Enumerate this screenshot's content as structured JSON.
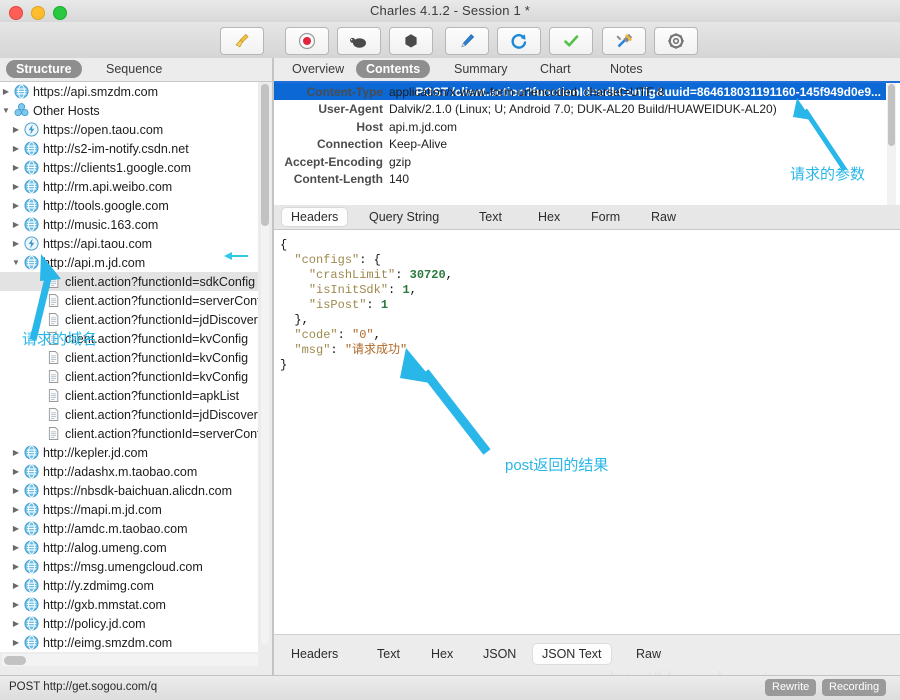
{
  "window": {
    "title": "Charles 4.1.2 - Session 1 *",
    "traffic_lights": [
      "close",
      "minimize",
      "zoom"
    ]
  },
  "toolbar": {
    "buttons": [
      {
        "name": "clear-session-button",
        "icon": "broom-icon"
      },
      {
        "name": "start-recording-button",
        "icon": "record-circle-icon"
      },
      {
        "name": "throttle-button",
        "icon": "turtle-icon"
      },
      {
        "name": "breakpoints-button",
        "icon": "stop-hexagon-icon"
      },
      {
        "name": "compose-button",
        "icon": "pen-icon"
      },
      {
        "name": "repeat-button",
        "icon": "refresh-icon"
      },
      {
        "name": "validate-button",
        "icon": "checkmark-icon"
      },
      {
        "name": "tools-button",
        "icon": "tools-icon"
      },
      {
        "name": "settings-button",
        "icon": "gear-icon"
      }
    ]
  },
  "left_pane": {
    "tabs": [
      {
        "label": "Structure",
        "active": true
      },
      {
        "label": "Sequence",
        "active": false
      }
    ],
    "tree": [
      {
        "label": "https://api.smzdm.com",
        "icon": "globe-icon",
        "depth": 0,
        "disclosure": "collapsed",
        "selected": false
      },
      {
        "label": "Other Hosts",
        "icon": "hosts-icon",
        "depth": 0,
        "disclosure": "expanded",
        "selected": false
      },
      {
        "label": "https://open.taou.com",
        "icon": "bolt-icon",
        "depth": 1,
        "disclosure": "collapsed",
        "selected": false
      },
      {
        "label": "http://s2-im-notify.csdn.net",
        "icon": "globe-icon",
        "depth": 1,
        "disclosure": "collapsed",
        "selected": false
      },
      {
        "label": "https://clients1.google.com",
        "icon": "globe-icon",
        "depth": 1,
        "disclosure": "collapsed",
        "selected": false
      },
      {
        "label": "http://rm.api.weibo.com",
        "icon": "globe-icon",
        "depth": 1,
        "disclosure": "collapsed",
        "selected": false
      },
      {
        "label": "http://tools.google.com",
        "icon": "globe-icon",
        "depth": 1,
        "disclosure": "collapsed",
        "selected": false
      },
      {
        "label": "http://music.163.com",
        "icon": "globe-icon",
        "depth": 1,
        "disclosure": "collapsed",
        "selected": false
      },
      {
        "label": "https://api.taou.com",
        "icon": "bolt-icon",
        "depth": 1,
        "disclosure": "collapsed",
        "selected": false
      },
      {
        "label": "http://api.m.jd.com",
        "icon": "globe-icon",
        "depth": 1,
        "disclosure": "expanded",
        "selected": false
      },
      {
        "label": "client.action?functionId=sdkConfig",
        "icon": "file-icon",
        "depth": 2,
        "disclosure": "none",
        "selected": true
      },
      {
        "label": "client.action?functionId=serverConfig",
        "icon": "file-icon",
        "depth": 2,
        "disclosure": "none",
        "selected": false
      },
      {
        "label": "client.action?functionId=jdDiscovery",
        "icon": "file-icon",
        "depth": 2,
        "disclosure": "none",
        "selected": false
      },
      {
        "label": "client.action?functionId=kvConfig",
        "icon": "file-icon",
        "depth": 2,
        "disclosure": "none",
        "selected": false
      },
      {
        "label": "client.action?functionId=kvConfig",
        "icon": "file-icon",
        "depth": 2,
        "disclosure": "none",
        "selected": false
      },
      {
        "label": "client.action?functionId=kvConfig",
        "icon": "file-icon",
        "depth": 2,
        "disclosure": "none",
        "selected": false
      },
      {
        "label": "client.action?functionId=apkList",
        "icon": "file-icon",
        "depth": 2,
        "disclosure": "none",
        "selected": false
      },
      {
        "label": "client.action?functionId=jdDiscovery",
        "icon": "file-icon",
        "depth": 2,
        "disclosure": "none",
        "selected": false
      },
      {
        "label": "client.action?functionId=serverConfig",
        "icon": "file-icon",
        "depth": 2,
        "disclosure": "none",
        "selected": false
      },
      {
        "label": "http://kepler.jd.com",
        "icon": "globe-icon",
        "depth": 1,
        "disclosure": "collapsed",
        "selected": false
      },
      {
        "label": "http://adashx.m.taobao.com",
        "icon": "globe-icon",
        "depth": 1,
        "disclosure": "collapsed",
        "selected": false
      },
      {
        "label": "https://nbsdk-baichuan.alicdn.com",
        "icon": "globe-icon",
        "depth": 1,
        "disclosure": "collapsed",
        "selected": false
      },
      {
        "label": "https://mapi.m.jd.com",
        "icon": "globe-icon",
        "depth": 1,
        "disclosure": "collapsed",
        "selected": false
      },
      {
        "label": "http://amdc.m.taobao.com",
        "icon": "globe-icon",
        "depth": 1,
        "disclosure": "collapsed",
        "selected": false
      },
      {
        "label": "http://alog.umeng.com",
        "icon": "globe-icon",
        "depth": 1,
        "disclosure": "collapsed",
        "selected": false
      },
      {
        "label": "https://msg.umengcloud.com",
        "icon": "globe-icon",
        "depth": 1,
        "disclosure": "collapsed",
        "selected": false
      },
      {
        "label": "http://y.zdmimg.com",
        "icon": "globe-icon",
        "depth": 1,
        "disclosure": "collapsed",
        "selected": false
      },
      {
        "label": "http://gxb.mmstat.com",
        "icon": "globe-icon",
        "depth": 1,
        "disclosure": "collapsed",
        "selected": false
      },
      {
        "label": "http://policy.jd.com",
        "icon": "globe-icon",
        "depth": 1,
        "disclosure": "collapsed",
        "selected": false
      },
      {
        "label": "http://eimg.smzdm.com",
        "icon": "globe-icon",
        "depth": 1,
        "disclosure": "collapsed",
        "selected": false
      }
    ]
  },
  "right_pane": {
    "tabs": [
      {
        "label": "Overview",
        "active": false
      },
      {
        "label": "Contents",
        "active": true
      },
      {
        "label": "Summary",
        "active": false
      },
      {
        "label": "Chart",
        "active": false
      },
      {
        "label": "Notes",
        "active": false
      }
    ],
    "request_line": "POST /client.action?functionId=sdkConfig&uuid=864618031191160-145f949d0e9...",
    "headers": [
      {
        "key": "Content-Type",
        "value": "application/x-www-form-urlencoded; charset=UTF-8"
      },
      {
        "key": "User-Agent",
        "value": "Dalvik/2.1.0 (Linux; U; Android 7.0; DUK-AL20 Build/HUAWEIDUK-AL20)"
      },
      {
        "key": "Host",
        "value": "api.m.jd.com"
      },
      {
        "key": "Connection",
        "value": "Keep-Alive"
      },
      {
        "key": "Accept-Encoding",
        "value": "gzip"
      },
      {
        "key": "Content-Length",
        "value": "140"
      }
    ],
    "request_tabs": [
      {
        "label": "Headers",
        "active": true
      },
      {
        "label": "Query String",
        "active": false
      },
      {
        "label": "Text",
        "active": false
      },
      {
        "label": "Hex",
        "active": false
      },
      {
        "label": "Form",
        "active": false
      },
      {
        "label": "Raw",
        "active": false
      }
    ],
    "response_tabs": [
      {
        "label": "Headers",
        "active": false
      },
      {
        "label": "Text",
        "active": false
      },
      {
        "label": "Hex",
        "active": false
      },
      {
        "label": "JSON",
        "active": false
      },
      {
        "label": "JSON Text",
        "active": true
      },
      {
        "label": "Raw",
        "active": false
      }
    ],
    "json_body": {
      "lines": [
        [
          {
            "t": "punct",
            "v": "{"
          }
        ],
        [
          {
            "t": "punct",
            "v": "  "
          },
          {
            "t": "key",
            "v": "\"configs\""
          },
          {
            "t": "punct",
            "v": ": {"
          }
        ],
        [
          {
            "t": "punct",
            "v": "    "
          },
          {
            "t": "key",
            "v": "\"crashLimit\""
          },
          {
            "t": "punct",
            "v": ": "
          },
          {
            "t": "num",
            "v": "30720"
          },
          {
            "t": "punct",
            "v": ","
          }
        ],
        [
          {
            "t": "punct",
            "v": "    "
          },
          {
            "t": "key",
            "v": "\"isInitSdk\""
          },
          {
            "t": "punct",
            "v": ": "
          },
          {
            "t": "num",
            "v": "1"
          },
          {
            "t": "punct",
            "v": ","
          }
        ],
        [
          {
            "t": "punct",
            "v": "    "
          },
          {
            "t": "key",
            "v": "\"isPost\""
          },
          {
            "t": "punct",
            "v": ": "
          },
          {
            "t": "num",
            "v": "1"
          }
        ],
        [
          {
            "t": "punct",
            "v": "  },"
          }
        ],
        [
          {
            "t": "punct",
            "v": "  "
          },
          {
            "t": "key",
            "v": "\"code\""
          },
          {
            "t": "punct",
            "v": ": "
          },
          {
            "t": "str",
            "v": "\"0\""
          },
          {
            "t": "punct",
            "v": ","
          }
        ],
        [
          {
            "t": "punct",
            "v": "  "
          },
          {
            "t": "key",
            "v": "\"msg\""
          },
          {
            "t": "punct",
            "v": ": "
          },
          {
            "t": "str",
            "v": "\"请求成功\""
          }
        ],
        [
          {
            "t": "punct",
            "v": "}"
          }
        ]
      ]
    }
  },
  "status_bar": {
    "current_request": "POST http://get.sogou.com/q",
    "rewrite_label": "Rewrite",
    "recording_label": "Recording"
  },
  "watermark": "http://blog.csdn.net/...",
  "annotations": [
    {
      "name": "annotation-request-domain",
      "text": "请求的域名"
    },
    {
      "name": "annotation-request-params",
      "text": "请求的参数"
    },
    {
      "name": "annotation-post-result",
      "text": "post返回的结果"
    }
  ],
  "colors": {
    "accent_blue": "#0b68d4",
    "annotation_cyan": "#29b6e8",
    "tab_active_gray": "#8e8e8e",
    "selection_gray": "#e3e3e3"
  }
}
